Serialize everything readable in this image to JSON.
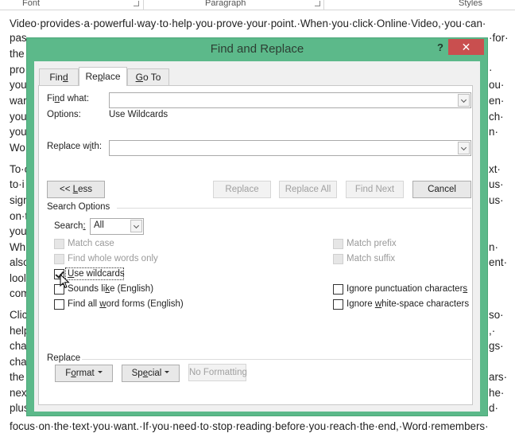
{
  "ribbon": {
    "groups": [
      {
        "label": "Font"
      },
      {
        "label": "Paragraph"
      },
      {
        "label": "Styles"
      }
    ]
  },
  "document": {
    "first_line": "Video·provides·a·powerful·way·to·help·you·prove·your·point.·When·you·click·Online·Video,·you·can·",
    "last_line": "focus·on·the·text·you·want.·If·you·need·to·stop·reading·before·you·reach·the·end,·Word·remembers·",
    "left_fragments": [
      "pas",
      "the",
      "pro",
      "you",
      "war",
      "you",
      "you",
      "Wo",
      "To·c",
      "to·i",
      "sign",
      "on·t",
      "you",
      "Wh",
      "also",
      "lool",
      "com",
      "Clic",
      "help",
      "cha",
      "cha",
      "the",
      "nex",
      "plus"
    ],
    "right_fragments": [
      "·for·",
      "·",
      "ou·",
      "en·",
      "ch·",
      "n·",
      "xt·",
      "us·",
      "us·",
      "n·",
      "ent·",
      "so·",
      ",·",
      "gs·",
      "ars·",
      "he·",
      "d·"
    ]
  },
  "dialog": {
    "title": "Find and Replace",
    "help_label": "?",
    "close_label": "✕",
    "colors": {
      "frame": "#5cb98a",
      "close": "#c94f4f"
    },
    "tabs": [
      {
        "label_pre": "Fin",
        "label_u": "d",
        "label_post": "",
        "active": false
      },
      {
        "label_pre": "Re",
        "label_u": "p",
        "label_post": "lace",
        "active": true
      },
      {
        "label_pre": "",
        "label_u": "G",
        "label_post": "o To",
        "active": false
      }
    ],
    "find_what": {
      "label_pre": "Fi",
      "label_u": "n",
      "label_post": "d what:",
      "value": ""
    },
    "options": {
      "label": "Options:",
      "value": "Use Wildcards"
    },
    "replace_with": {
      "label_pre": "Replace w",
      "label_u": "i",
      "label_post": "th:",
      "value": ""
    },
    "buttons": {
      "less_pre": "<< ",
      "less_u": "L",
      "less_post": "ess",
      "replace": "Replace",
      "replace_all": "Replace All",
      "find_next": "Find Next",
      "cancel": "Cancel"
    },
    "search_options": {
      "heading": "Search Options",
      "search_label_pre": "Search",
      "search_label_u": ":",
      "search_value": "All",
      "left_checks": [
        {
          "label": "Match case",
          "checked": false,
          "disabled": true
        },
        {
          "label": "Find whole words only",
          "checked": false,
          "disabled": true
        },
        {
          "label_u": "U",
          "label": "se wildcards",
          "checked": true,
          "disabled": false
        },
        {
          "label_pre": "Sounds li",
          "label_u": "k",
          "label": "e (English)",
          "checked": false,
          "disabled": false
        },
        {
          "label_pre": "Find all ",
          "label_u": "w",
          "label": "ord forms (English)",
          "checked": false,
          "disabled": false
        }
      ],
      "right_checks": [
        {
          "label": "Match prefix",
          "checked": false,
          "disabled": true
        },
        {
          "label": "Match suffix",
          "checked": false,
          "disabled": true
        },
        {
          "label_pre": "Ignore punctuation character",
          "label_u": "s",
          "label": "",
          "checked": false,
          "disabled": false
        },
        {
          "label_pre": "Ignore ",
          "label_u": "w",
          "label": "hite-space characters",
          "checked": false,
          "disabled": false
        }
      ]
    },
    "replace_section": {
      "heading": "Replace",
      "format_pre": "F",
      "format_u": "o",
      "format_post": "rmat",
      "special_pre": "Sp",
      "special_u": "e",
      "special_post": "cial",
      "no_formatting": "No Formatting"
    }
  }
}
